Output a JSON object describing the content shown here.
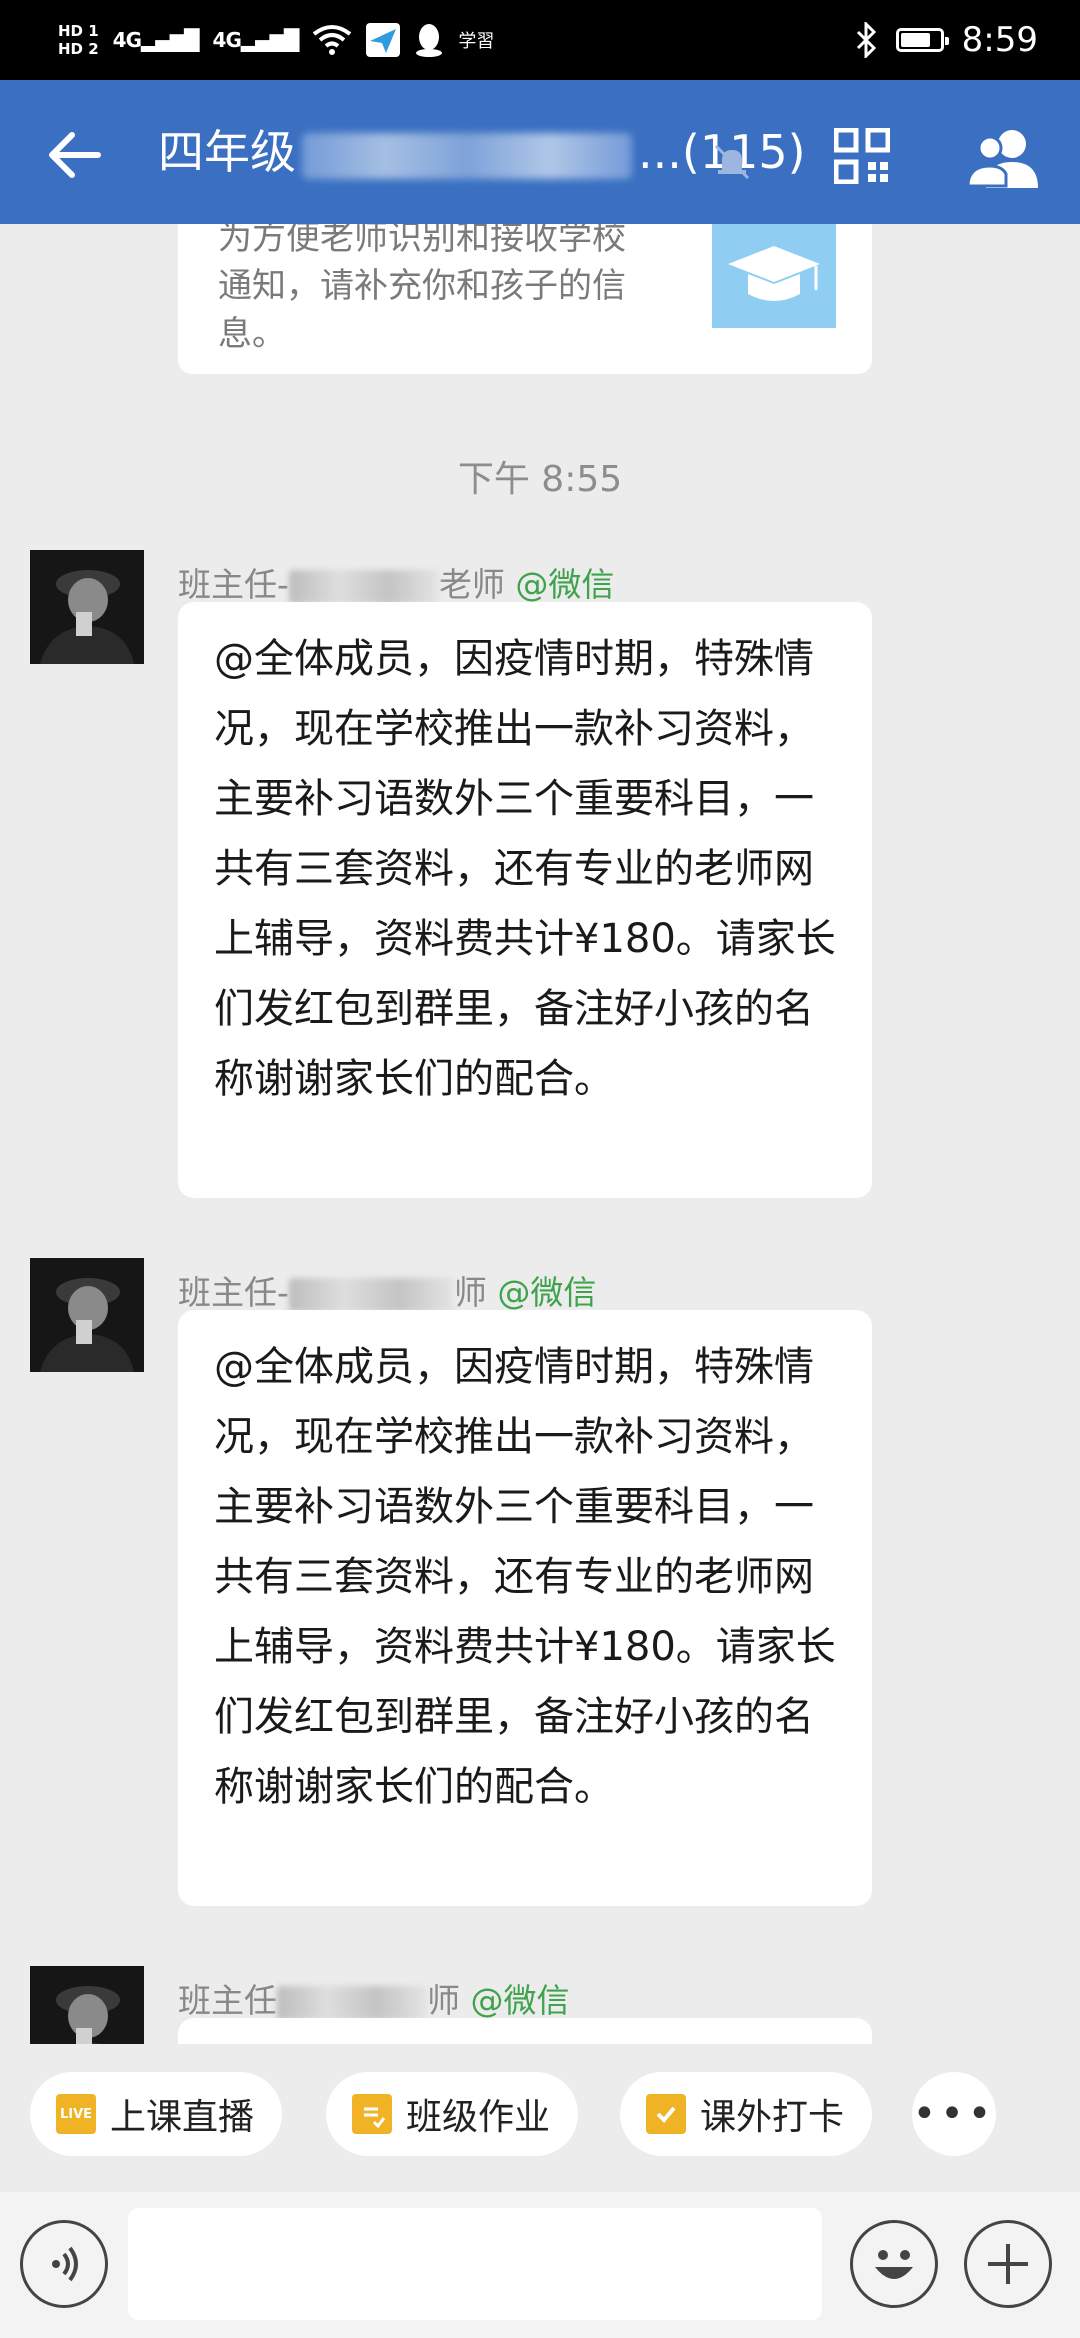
{
  "status_bar": {
    "hd1": "HD 1",
    "hd2": "HD 2",
    "signal1": "4G",
    "signal2": "4G",
    "app_label": "学習",
    "time": "8:59"
  },
  "header": {
    "title_prefix": "四年级",
    "title_suffix": "...(115)"
  },
  "notice": {
    "text": "为方便老师识别和接收学校通知，请补充你和孩子的信息。"
  },
  "timestamp": "下午 8:55",
  "messages": [
    {
      "sender_prefix": "班主任-",
      "sender_suffix": "老师",
      "source": "@微信",
      "text": "@全体成员，因疫情时期，特殊情况，现在学校推出一款补习资料，主要补习语数外三个重要科目，一共有三套资料，还有专业的老师网上辅导，资料费共计¥180。请家长们发红包到群里，备注好小孩的名称谢谢家长们的配合。"
    },
    {
      "sender_prefix": "班主任-",
      "sender_suffix": "师",
      "source": "@微信",
      "text": "@全体成员，因疫情时期，特殊情况，现在学校推出一款补习资料，主要补习语数外三个重要科目，一共有三套资料，还有专业的老师网上辅导，资料费共计¥180。请家长们发红包到群里，备注好小孩的名称谢谢家长们的配合。"
    },
    {
      "sender_prefix": "班主任",
      "sender_suffix": "师",
      "source": "@微信",
      "text": ""
    }
  ],
  "quick_actions": [
    {
      "label": "上课直播",
      "icon": "live-icon",
      "icon_text": "LIVE"
    },
    {
      "label": "班级作业",
      "icon": "homework-icon",
      "icon_text": ""
    },
    {
      "label": "课外打卡",
      "icon": "checkin-icon",
      "icon_text": ""
    }
  ],
  "input": {
    "placeholder": ""
  },
  "colors": {
    "header_bg": "#3a6fc1",
    "wechat_green": "#3fa34d",
    "chip_icon": "#f0b325"
  }
}
